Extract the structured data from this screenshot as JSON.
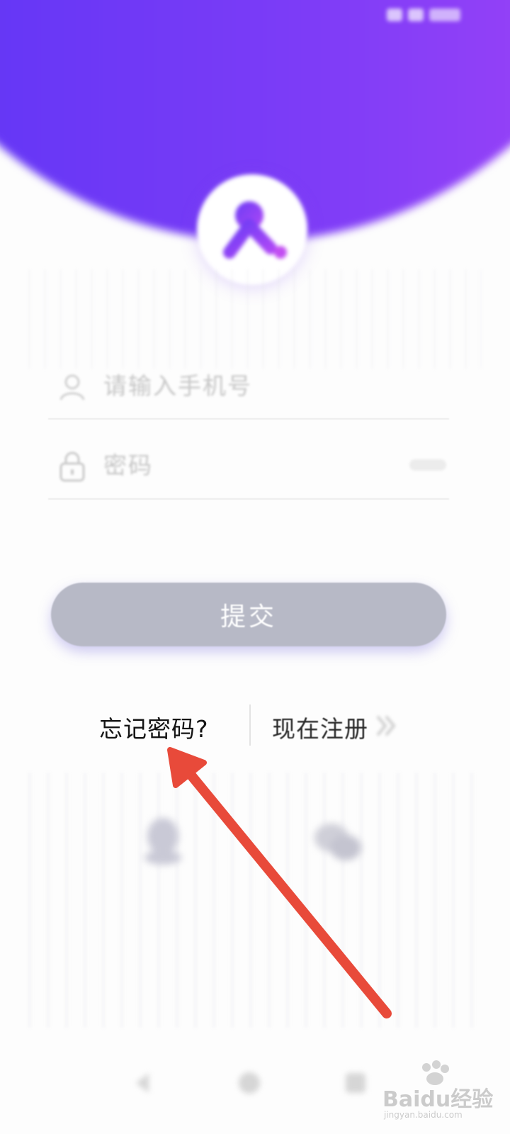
{
  "status_bar": {
    "left_text": "",
    "icons": [
      "signal-icon",
      "wifi-icon",
      "battery-icon"
    ]
  },
  "header": {
    "gradient_start": "#5a34f5",
    "gradient_end": "#a244f8",
    "logo_icon": "app-logo-icon"
  },
  "form": {
    "phone": {
      "placeholder": "请输入手机号",
      "value": "",
      "icon": "user-icon"
    },
    "password": {
      "placeholder": "密码",
      "value": "",
      "icon": "lock-icon"
    },
    "submit_label": "提交"
  },
  "links": {
    "forgot_password": "忘记密码?",
    "register_now": "现在注册",
    "register_icon": "chevron-right-double-icon"
  },
  "social_login": [
    {
      "name": "qq",
      "icon": "qq-icon"
    },
    {
      "name": "wechat",
      "icon": "wechat-icon"
    }
  ],
  "annotation": {
    "arrow_color": "#e84a3a"
  },
  "watermark": {
    "brand": "Baidu经验",
    "url": "jingyan.baidu.com"
  }
}
